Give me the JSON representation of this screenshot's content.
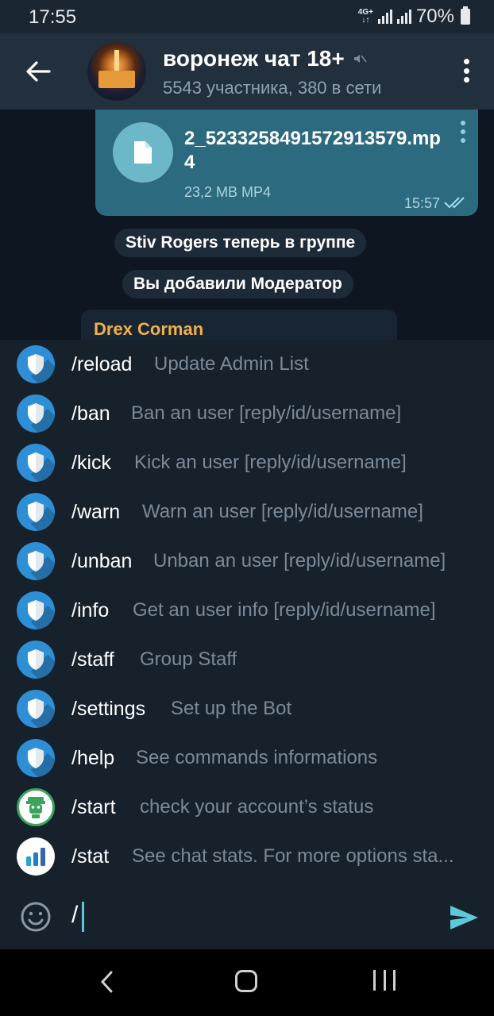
{
  "status": {
    "time": "17:55",
    "network": "4G+",
    "battery": "70%"
  },
  "header": {
    "title": "воронеж чат 18+",
    "subtitle": "5543 участника, 380 в сети"
  },
  "messages": {
    "file": {
      "name": "2_5233258491572913579.mp4",
      "meta": "23,2 MB MP4",
      "time": "15:57"
    },
    "service1": "Stiv Rogers теперь в группе",
    "service2": "Вы добавили Модератор",
    "peek_sender": "Drex Corman"
  },
  "commands": [
    {
      "name": "/reload",
      "desc": "Update Admin List",
      "icon": "shield-bot-icon"
    },
    {
      "name": "/ban",
      "desc": "Ban an user [reply/id/username]",
      "icon": "shield-bot-icon"
    },
    {
      "name": "/kick",
      "desc": "Kick an user [reply/id/username]",
      "icon": "shield-bot-icon"
    },
    {
      "name": "/warn",
      "desc": "Warn an user [reply/id/username]",
      "icon": "shield-bot-icon"
    },
    {
      "name": "/unban",
      "desc": "Unban an user [reply/id/username]",
      "icon": "shield-bot-icon"
    },
    {
      "name": "/info",
      "desc": "Get an user info [reply/id/username]",
      "icon": "shield-bot-icon"
    },
    {
      "name": "/staff",
      "desc": "Group Staff",
      "icon": "shield-bot-icon"
    },
    {
      "name": "/settings",
      "desc": "Set up the Bot",
      "icon": "shield-bot-icon"
    },
    {
      "name": "/help",
      "desc": "See commands informations",
      "icon": "shield-bot-icon"
    },
    {
      "name": "/start",
      "desc": "check your account’s status",
      "icon": "green-bot-icon"
    },
    {
      "name": "/stat",
      "desc": "See chat stats. For more options sta...",
      "icon": "chart-bot-icon"
    }
  ],
  "input": {
    "text": "/"
  },
  "colors": {
    "accent": "#5ec8d8",
    "outgoing_bubble": "#2c6b7f",
    "sender_name": "#f2b04a"
  }
}
